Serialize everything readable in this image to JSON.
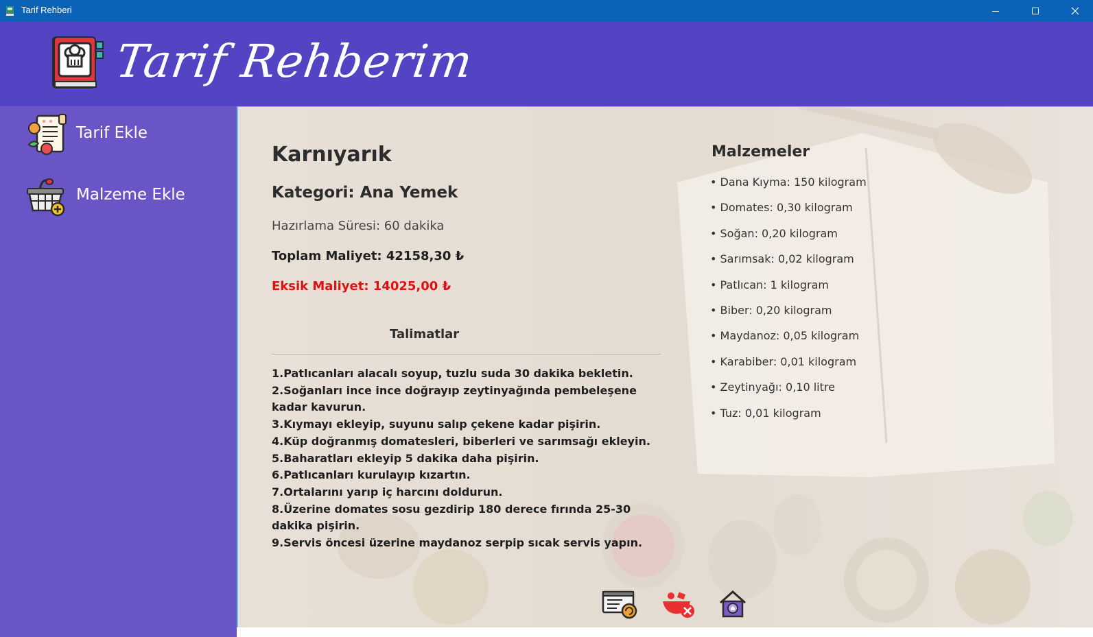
{
  "window": {
    "title": "Tarif Rehberi",
    "controls": [
      "minimize",
      "maximize",
      "close"
    ]
  },
  "header": {
    "logo_text": "Tarif Rehberim",
    "logo_icon": "recipe-book-chef-hat-icon"
  },
  "sidebar": {
    "items": [
      {
        "label": "Tarif Ekle",
        "icon": "recipe-document-icon"
      },
      {
        "label": "Malzeme Ekle",
        "icon": "basket-add-icon"
      }
    ]
  },
  "recipe": {
    "title": "Karnıyarık",
    "category": "Kategori: Ana Yemek",
    "prep_time": "Hazırlama Süresi: 60 dakika",
    "total_cost": "Toplam Maliyet: 42158,30 ₺",
    "missing_cost": "Eksik Maliyet: 14025,00 ₺",
    "instructions_heading": "Talimatlar",
    "instructions": [
      "1.Patlıcanları alacalı soyup, tuzlu suda 30 dakika bekletin.",
      "2.Soğanları ince ince doğrayıp zeytinyağında pembeleşene kadar kavurun.",
      "3.Kıymayı ekleyip, suyunu salıp çekene kadar pişirin.",
      "4.Küp doğranmış domatesleri, biberleri ve sarımsağı ekleyin.",
      "5.Baharatları ekleyip 5 dakika daha pişirin.",
      "6.Patlıcanları kurulayıp kızartın.",
      "7.Ortalarını yarıp iç harcını doldurun.",
      "8.Üzerine domates sosu gezdirip 180 derece fırında 25-30 dakika pişirin.",
      "9.Servis öncesi üzerine maydanoz serpip sıcak servis yapın."
    ],
    "ingredients_heading": "Malzemeler",
    "ingredients": [
      "• Dana Kıyma: 150 kilogram",
      "• Domates: 0,30 kilogram",
      "• Soğan: 0,20 kilogram",
      "• Sarımsak: 0,02 kilogram",
      "• Patlıcan: 1 kilogram",
      "• Biber: 0,20 kilogram",
      "• Maydanoz: 0,05 kilogram",
      "• Karabiber: 0,01 kilogram",
      "• Zeytinyağı: 0,10 litre",
      "• Tuz: 0,01 kilogram"
    ]
  },
  "actions": [
    {
      "icon": "update-recipe-icon"
    },
    {
      "icon": "delete-recipe-icon"
    },
    {
      "icon": "home-icon"
    }
  ],
  "colors": {
    "titlebar": "#0a63b6",
    "header": "#5244c2",
    "sidebar": "#6a55c6",
    "missing_cost": "#e01010"
  }
}
